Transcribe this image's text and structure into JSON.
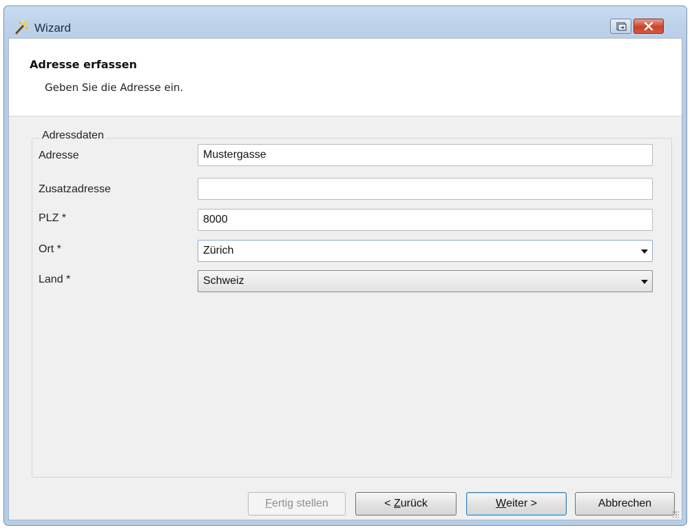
{
  "window": {
    "title": "Wizard",
    "icon": "magic-wand-icon"
  },
  "header": {
    "title": "Adresse erfassen",
    "subtitle": "Geben Sie die Adresse ein."
  },
  "group": {
    "legend": "Adressdaten",
    "fields": [
      {
        "label": "Adresse",
        "value": "Mustergasse",
        "type": "text"
      },
      {
        "label": "Zusatzadresse",
        "value": "",
        "type": "text"
      },
      {
        "label": "PLZ *",
        "value": "8000",
        "type": "text"
      },
      {
        "label": "Ort *",
        "value": "Zürich",
        "type": "combobox-editable"
      },
      {
        "label": "Land *",
        "value": "Schweiz",
        "type": "combobox-dropdownlist"
      }
    ]
  },
  "buttons": {
    "finish": {
      "mnemonic": "F",
      "rest": "ertig stellen",
      "enabled": false
    },
    "back": {
      "prefix": "< ",
      "mnemonic": "Z",
      "rest": "urück"
    },
    "next": {
      "mnemonic": "W",
      "rest": "eiter >"
    },
    "cancel": {
      "label": "Abbrechen"
    }
  },
  "colors": {
    "titlebar": "#bcd2ea",
    "client": "#f0f0f0",
    "close": "#c8432c"
  }
}
